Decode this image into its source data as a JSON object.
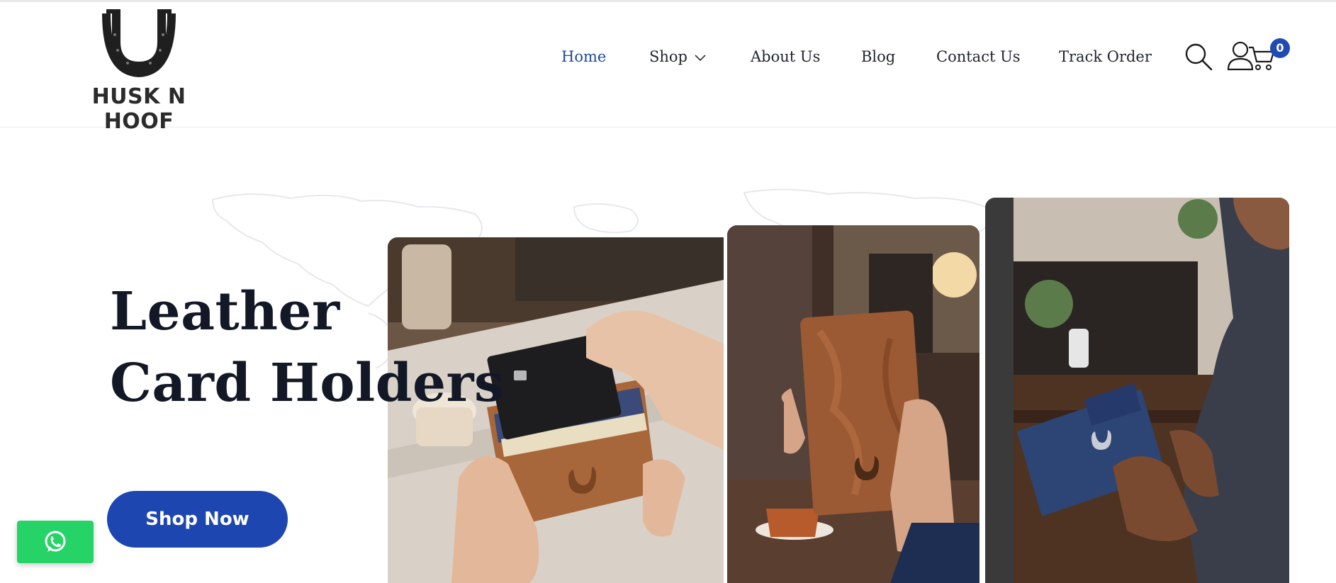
{
  "brand": {
    "name": "HUSK N HOOF"
  },
  "nav": {
    "items": [
      {
        "label": "Home",
        "active": true
      },
      {
        "label": "Shop",
        "has_dropdown": true
      },
      {
        "label": "About Us"
      },
      {
        "label": "Blog"
      },
      {
        "label": "Contact Us"
      },
      {
        "label": "Track Order"
      }
    ]
  },
  "header_icons": {
    "search": "search-icon",
    "account": "user-icon",
    "cart": "cart-icon",
    "cart_count": "0"
  },
  "hero": {
    "title_line1": "Leather",
    "title_line2": "Card Holders",
    "cta_label": "Shop Now",
    "images": [
      "tan leather card holder with black card in hands",
      "brown leather passport cover held in hand",
      "blue leather wallet held by man at cafe"
    ]
  },
  "floating": {
    "whatsapp": "whatsapp-icon"
  },
  "colors": {
    "accent": "#1e46b1",
    "nav_active": "#1e4a9a",
    "whatsapp": "#25d366",
    "text_dark": "#121826"
  }
}
